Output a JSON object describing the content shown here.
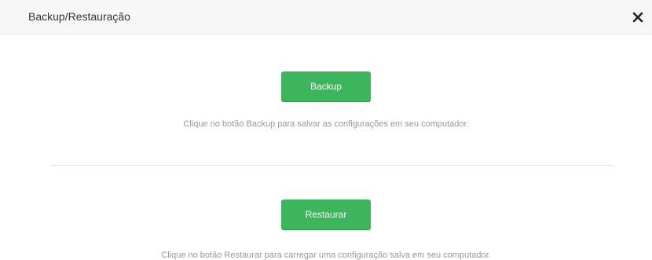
{
  "dialog": {
    "title": "Backup/Restauração",
    "close_icon": "close-icon"
  },
  "backup": {
    "button_label": "Backup",
    "hint": "Clique no botão Backup para salvar as configurações em seu computador."
  },
  "restore": {
    "button_label": "Restaurar",
    "hint": "Clique no botão Restaurar para carregar uma configuração salva em seu computador."
  },
  "colors": {
    "button_green": "#3cb55c",
    "header_bg": "#f7f7f7",
    "hint_text": "#999999"
  }
}
